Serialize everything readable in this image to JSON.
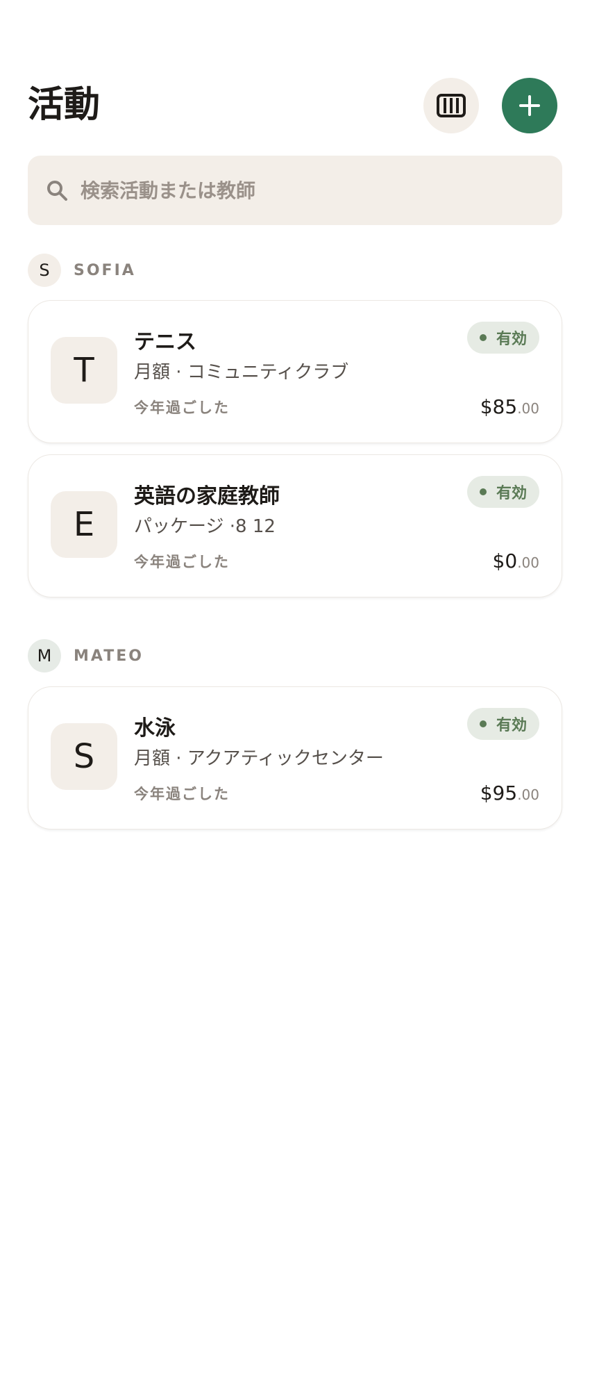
{
  "header": {
    "title": "活動",
    "calendar_icon": "calendar-grid-icon",
    "add_icon": "plus-icon"
  },
  "search": {
    "placeholder": "検索活動または教師",
    "value": ""
  },
  "groups": [
    {
      "initial": "S",
      "name": "SOFIA",
      "activities": [
        {
          "initial": "T",
          "title": "テニス",
          "subtitle": "月額 · コミュニティクラブ",
          "meta": "今年過ごした",
          "status": "有効",
          "price_main": "$85",
          "price_cents": ".00"
        },
        {
          "initial": "E",
          "title": "英語の家庭教師",
          "subtitle": "パッケージ ·8 12",
          "meta": "今年過ごした",
          "status": "有効",
          "price_main": "$0",
          "price_cents": ".00"
        }
      ]
    },
    {
      "initial": "M",
      "name": "MATEO",
      "activities": [
        {
          "initial": "S",
          "title": "水泳",
          "subtitle": "月額 · アクアティックセンター",
          "meta": "今年過ごした",
          "status": "有効",
          "price_main": "$95",
          "price_cents": ".00"
        }
      ]
    }
  ],
  "colors": {
    "accent": "#2e7a59",
    "surface": "#f3eee8",
    "status_active": "#5a7a55"
  }
}
